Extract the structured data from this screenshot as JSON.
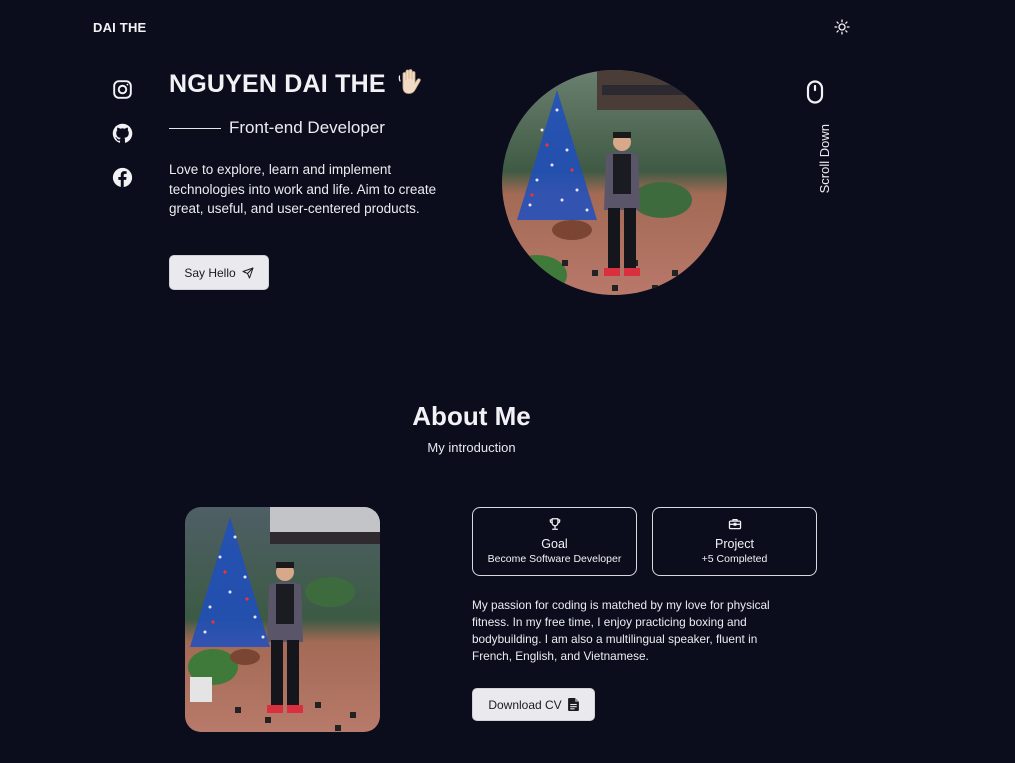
{
  "header": {
    "logo": "DAI THE",
    "theme_toggle_icon": "sun-icon"
  },
  "hero": {
    "socials": [
      {
        "icon": "instagram-icon"
      },
      {
        "icon": "github-icon"
      },
      {
        "icon": "facebook-icon"
      }
    ],
    "title": "NGUYEN DAI THE",
    "title_emoji_icon": "waving-hand-icon",
    "subtitle": "Front-end Developer",
    "description": "Love to explore, learn and implement technologies into work and life. Aim to create great, useful, and user-centered products.",
    "say_hello_label": "Say Hello",
    "say_hello_icon": "send-icon",
    "scroll_down_label": "Scroll Down",
    "scroll_icon": "mouse-icon"
  },
  "about": {
    "title": "About Me",
    "subtitle": "My introduction",
    "cards": [
      {
        "icon": "trophy-icon",
        "title": "Goal",
        "subtitle": "Become Software Developer"
      },
      {
        "icon": "briefcase-icon",
        "title": "Project",
        "subtitle": "+5 Completed"
      }
    ],
    "description": "My passion for coding is matched by my love for physical fitness. In my free time, I enjoy practicing boxing and bodybuilding. I am also a multilingual speaker, fluent in French, English, and Vietnamese.",
    "download_cv_label": "Download CV",
    "download_cv_icon": "document-icon"
  },
  "colors": {
    "background": "#0b0d1d",
    "text": "#f2f2f5",
    "button_bg": "#e9e9ee"
  }
}
